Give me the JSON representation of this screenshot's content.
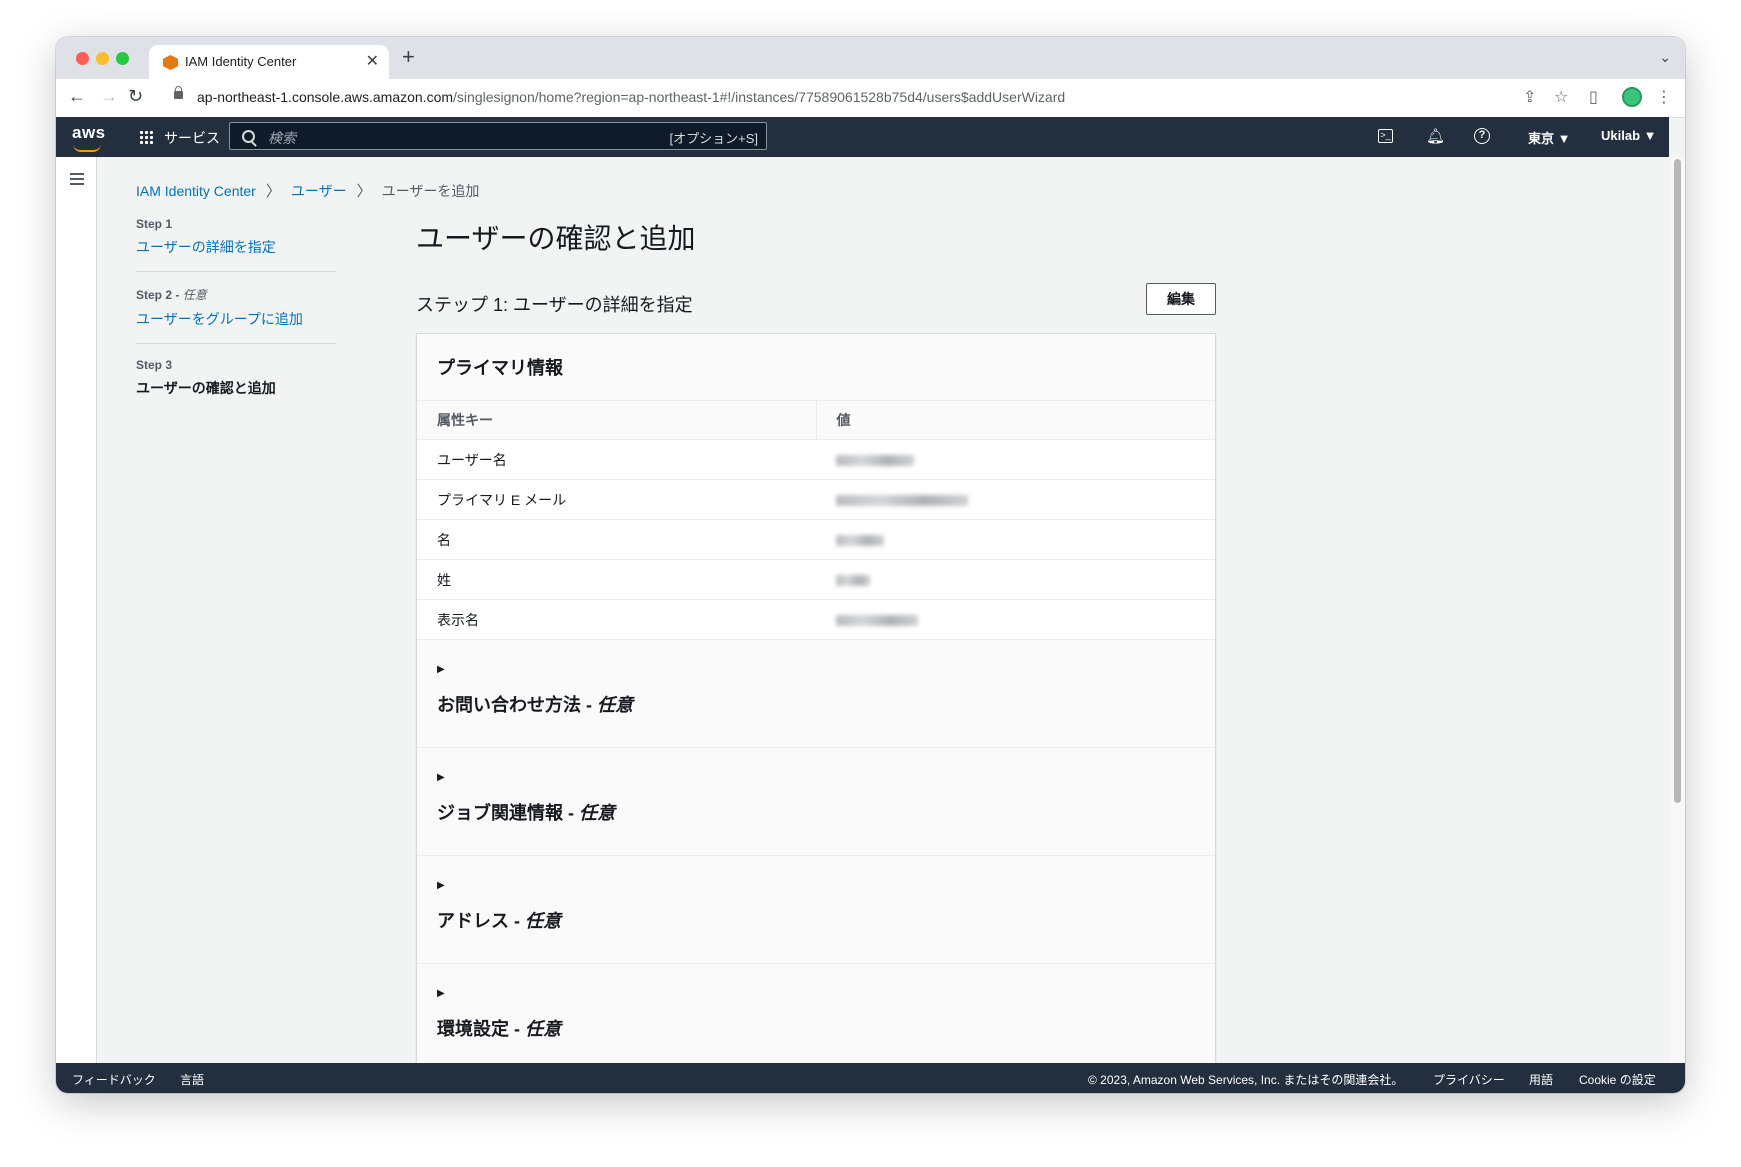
{
  "browser": {
    "tab_title": "IAM Identity Center",
    "tab_close": "✕",
    "new_tab": "+",
    "url_host": "ap-northeast-1.console.aws.amazon.com",
    "url_path": "/singlesignon/home?region=ap-northeast-1#!/instances/77589061528b75d4/users$addUserWizard"
  },
  "aws_header": {
    "logo": "aws",
    "services_label": "サービス",
    "search_placeholder": "検索",
    "search_shortcut": "[オプション+S]",
    "region": "東京 ▼",
    "account": "Ukilab ▼"
  },
  "breadcrumb": {
    "items": [
      "IAM Identity Center",
      "ユーザー"
    ],
    "current": "ユーザーを追加"
  },
  "steps": [
    {
      "num": "Step 1",
      "label": "ユーザーの詳細を指定"
    },
    {
      "num": "Step 2",
      "optional": "任意",
      "label": "ユーザーをグループに追加"
    },
    {
      "num": "Step 3",
      "label": "ユーザーの確認と追加"
    }
  ],
  "main": {
    "title": "ユーザーの確認と追加",
    "section_title": "ステップ 1: ユーザーの詳細を指定",
    "edit_label": "編集",
    "primary_info": {
      "header": "プライマリ情報",
      "columns": [
        "属性キー",
        "値"
      ],
      "rows": [
        {
          "key": "ユーザー名"
        },
        {
          "key": "プライマリ E メール"
        },
        {
          "key": "名"
        },
        {
          "key": "姓"
        },
        {
          "key": "表示名"
        }
      ]
    },
    "expanders": [
      {
        "title": "お問い合わせ方法",
        "suffix": "任意"
      },
      {
        "title": "ジョブ関連情報",
        "suffix": "任意"
      },
      {
        "title": "アドレス",
        "suffix": "任意"
      },
      {
        "title": "環境設定",
        "suffix": "任意"
      }
    ]
  },
  "footer": {
    "feedback": "フィードバック",
    "language": "言語",
    "copyright": "© 2023, Amazon Web Services, Inc. またはその関連会社。",
    "privacy": "プライバシー",
    "terms": "用語",
    "cookie": "Cookie の設定"
  }
}
